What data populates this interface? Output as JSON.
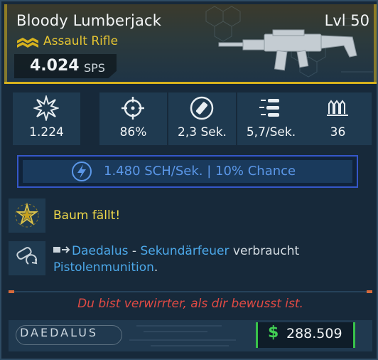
{
  "weapon": {
    "name": "Bloody Lumberjack",
    "level": "Lvl 50",
    "type": "Assault Rifle",
    "sps_value": "4.024",
    "sps_unit": "SPS",
    "rarity_icon": "rarity-chevron-icon"
  },
  "stats": [
    {
      "icon": "damage-burst-icon",
      "value": "1.224"
    },
    {
      "icon": "crosshair-icon",
      "value": "86%"
    },
    {
      "icon": "reload-timer-icon",
      "value": "2,3 Sek."
    },
    {
      "icon": "fire-rate-icon",
      "value": "5,7/Sek."
    },
    {
      "icon": "magazine-icon",
      "value": "36"
    }
  ],
  "elemental": {
    "icon": "lightning-shock-icon",
    "text": "1.480 SCH/Sek. | 10% Chance",
    "color": "#5b97e8"
  },
  "perks": [
    {
      "icon": "star-badge-icon",
      "text": "Baum fällt!"
    },
    {
      "icon": "ammo-swap-icon",
      "manufacturer": "Daedalus",
      "separator": " - ",
      "feature": "Sekundärfeuer",
      "verb": " verbraucht",
      "ammo": "Pistolenmunition",
      "end": "."
    }
  ],
  "flavor_text": "Du bist verwirrter, als dir bewusst ist.",
  "footer": {
    "manufacturer_logo": "DAEDALUS",
    "currency_icon": "$",
    "price": "288.509"
  },
  "colors": {
    "rarity": "#d7b21d",
    "highlight": "#4ca8e9",
    "flavor": "#e04a44",
    "price_accent": "#38c24a"
  }
}
